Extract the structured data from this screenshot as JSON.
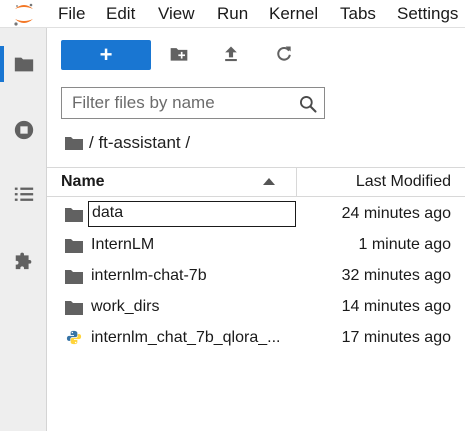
{
  "menubar": {
    "items": [
      "File",
      "Edit",
      "View",
      "Run",
      "Kernel",
      "Tabs",
      "Settings"
    ]
  },
  "sidebar": {
    "icons": [
      "folder-icon",
      "running-icon",
      "table-of-contents-icon",
      "extension-icon"
    ]
  },
  "toolbar": {
    "new_label": "+",
    "icons": [
      "new-folder-icon",
      "upload-icon",
      "refresh-icon"
    ]
  },
  "search": {
    "placeholder": "Filter files by name",
    "value": ""
  },
  "breadcrumb": {
    "path": "/ ft-assistant /"
  },
  "file_list": {
    "columns": {
      "name": "Name",
      "modified": "Last Modified"
    },
    "sort": "ascending",
    "rows": [
      {
        "name": "data",
        "modified": "24 minutes ago",
        "icon": "folder-icon"
      },
      {
        "name": "InternLM",
        "modified": "1 minute ago",
        "icon": "folder-icon"
      },
      {
        "name": "internlm-chat-7b",
        "modified": "32 minutes ago",
        "icon": "folder-icon"
      },
      {
        "name": "work_dirs",
        "modified": "14 minutes ago",
        "icon": "folder-icon"
      },
      {
        "name": "internlm_chat_7b_qlora_...",
        "modified": "17 minutes ago",
        "icon": "python-file-icon"
      }
    ]
  },
  "colors": {
    "accent": "#1976d2",
    "logo": "#f37726"
  }
}
